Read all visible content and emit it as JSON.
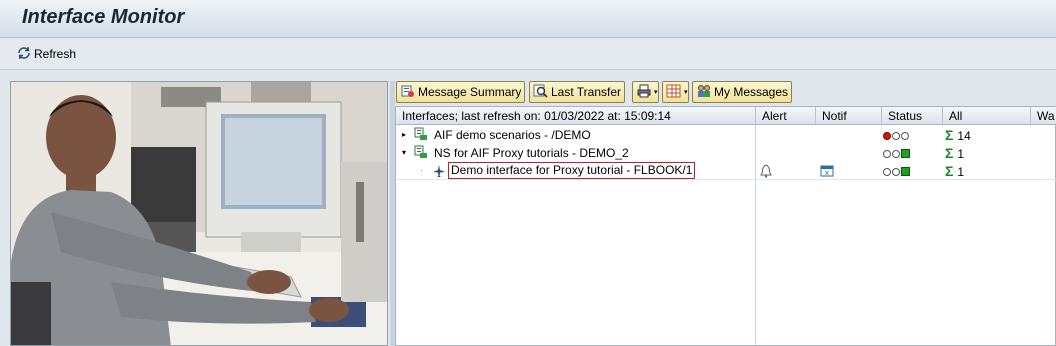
{
  "window": {
    "title": "Interface Monitor"
  },
  "toolbar": {
    "refresh_label": "Refresh",
    "refresh_icon": "refresh-icon"
  },
  "buttons": {
    "message_summary": "Message Summary",
    "last_transfer": "Last Transfer",
    "my_messages": "My Messages"
  },
  "grid": {
    "columns": {
      "interfaces": "Interfaces; last refresh on: 01/03/2022 at: 15:09:14",
      "alert": "Alert",
      "notif": "Notif",
      "status": "Status",
      "all": "All",
      "wa": "Wa"
    },
    "rows": [
      {
        "name": "AIF demo scenarios - /DEMO",
        "expanded": false,
        "status": "red",
        "all": "14"
      },
      {
        "name": "NS for AIF Proxy tutorials - DEMO_2",
        "expanded": true,
        "status": "green",
        "all": "1"
      },
      {
        "name": "Demo interface for Proxy tutorial - FLBOOK/1",
        "expanded": null,
        "status": "green",
        "all": "1"
      }
    ]
  },
  "colors": {
    "title_bg": "#d4dee8",
    "button_bg": "#f0e39a",
    "green": "#1ea31e",
    "red": "#e01010"
  }
}
